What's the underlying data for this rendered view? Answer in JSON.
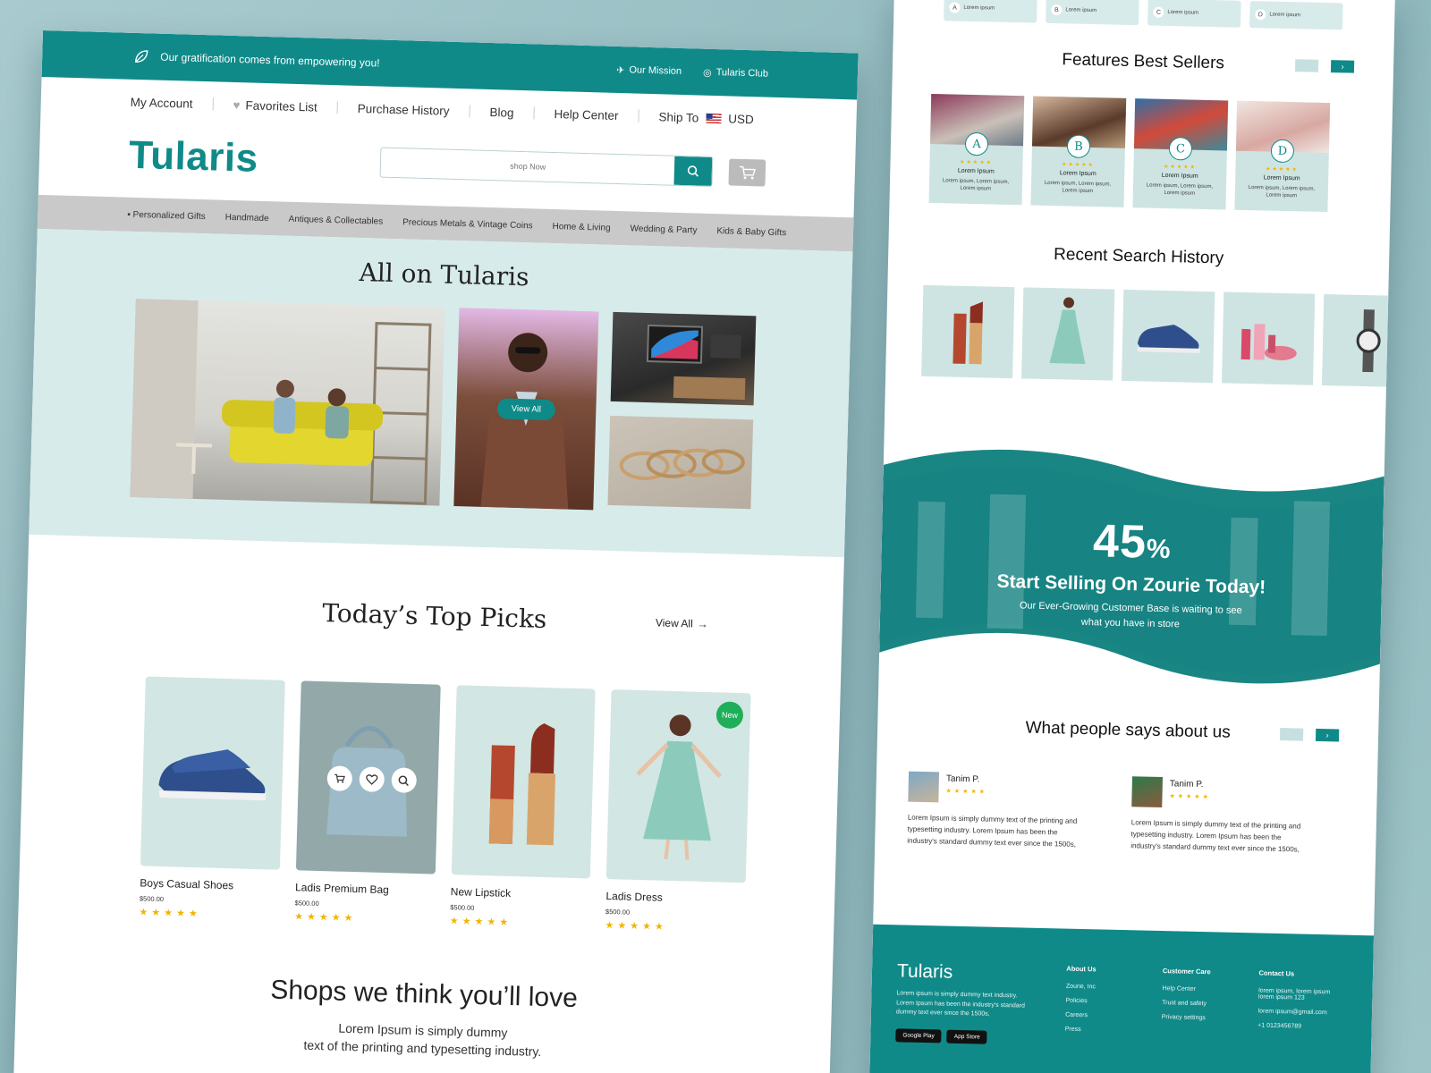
{
  "topbar": {
    "tagline": "Our gratification comes from empowering you!",
    "links": [
      "Our Mission",
      "Tularis Club"
    ]
  },
  "account_nav": {
    "my_account": "My Account",
    "favorites": "Favorites List",
    "purchase_history": "Purchase History",
    "blog": "Blog",
    "help_center": "Help Center",
    "ship_to": "Ship To",
    "currency": "USD"
  },
  "brand": {
    "logo": "Tularis"
  },
  "search": {
    "placeholder": "shop Now"
  },
  "categories": [
    "Personalized Gifts",
    "Handmade",
    "Antiques & Collectables",
    "Precious Metals & Vintage Coins",
    "Home & Living",
    "Wedding & Party",
    "Kids & Baby Gifts"
  ],
  "hero": {
    "title": "All on Tularis",
    "view_all": "View All"
  },
  "top_picks": {
    "title": "Today’s Top Picks",
    "view_all": "View All",
    "products": [
      {
        "name": "Boys Casual Shoes",
        "price": "$500.00",
        "stars": "★★★★★"
      },
      {
        "name": "Ladis Premium Bag",
        "price": "$500.00",
        "stars": "★★★★★"
      },
      {
        "name": "New Lipstick",
        "price": "$500.00",
        "stars": "★★★★★"
      },
      {
        "name": "Ladis Dress",
        "price": "$500.00",
        "stars": "★★★★★",
        "badge": "New"
      }
    ]
  },
  "shops": {
    "title": "Shops we think you’ll love",
    "text_line1": "Lorem Ipsum is simply dummy",
    "text_line2": "text of the printing and typesetting industry."
  },
  "mini_cards": [
    {
      "letter": "A",
      "text": "Lorem ipsum"
    },
    {
      "letter": "B",
      "text": "Lorem ipsum"
    },
    {
      "letter": "C",
      "text": "Lorem ipsum"
    },
    {
      "letter": "D",
      "text": "Lorem ipsum"
    }
  ],
  "best_sellers": {
    "title": "Features Best Sellers",
    "items": [
      {
        "letter": "A",
        "name": "Lorem Ipsum",
        "desc": "Lorem ipsum, Lorem ipsum, Lorem ipsum",
        "stars": "★★★★★"
      },
      {
        "letter": "B",
        "name": "Lorem Ipsum",
        "desc": "Lorem ipsum, Lorem ipsum, Lorem ipsum",
        "stars": "★★★★★"
      },
      {
        "letter": "C",
        "name": "Lorem Ipsum",
        "desc": "Lorem ipsum, Lorem ipsum, Lorem ipsum",
        "stars": "★★★★★"
      },
      {
        "letter": "D",
        "name": "Lorem Ipsum",
        "desc": "Lorem ipsum, Lorem ipsum, Lorem ipsum",
        "stars": "★★★★★"
      }
    ]
  },
  "recent_search": {
    "title": "Recent Search History"
  },
  "promo": {
    "percent": "45",
    "percent_sign": "%",
    "headline": "Start Selling On Zourie Today!",
    "sub_line1": "Our Ever-Growing Customer Base is waiting to see",
    "sub_line2": "what you have in store"
  },
  "testimonials": {
    "title": "What people says about us",
    "items": [
      {
        "name": "Tanim P.",
        "stars": "★★★★★",
        "text": "Lorem Ipsum is simply dummy text of the printing and typesetting industry. Lorem Ipsum has been the industry's standard dummy text ever since the 1500s,"
      },
      {
        "name": "Tanim P.",
        "stars": "★★★★★",
        "text": "Lorem Ipsum is simply dummy text of the printing and typesetting industry. Lorem Ipsum has been the industry's standard dummy text ever since the 1500s,"
      }
    ]
  },
  "footer": {
    "logo": "Tularis",
    "about_text": "Lorem ipsum is simply dummy text industry. Lorem Ipsum has been the industry's standard dummy text ever since the 1500s,",
    "columns": [
      {
        "heading": "About Us",
        "items": [
          "Zourie, Inc",
          "Policies",
          "Careers",
          "Press"
        ]
      },
      {
        "heading": "Customer Care",
        "items": [
          "Help Center",
          "Trust and safety",
          "Privacy settings"
        ]
      },
      {
        "heading": "Contact Us",
        "items": [
          "lorem ipsum, lorem ipsum lorem ipsum 123",
          "lorem ipsum@gmail.com",
          "+1 0123456789"
        ]
      }
    ],
    "stores": [
      "Google Play",
      "App Store"
    ]
  },
  "colors": {
    "primary": "#0f8a89",
    "hero_bg": "#d7ebea",
    "star": "#f2b400",
    "badge": "#1fae5a"
  }
}
